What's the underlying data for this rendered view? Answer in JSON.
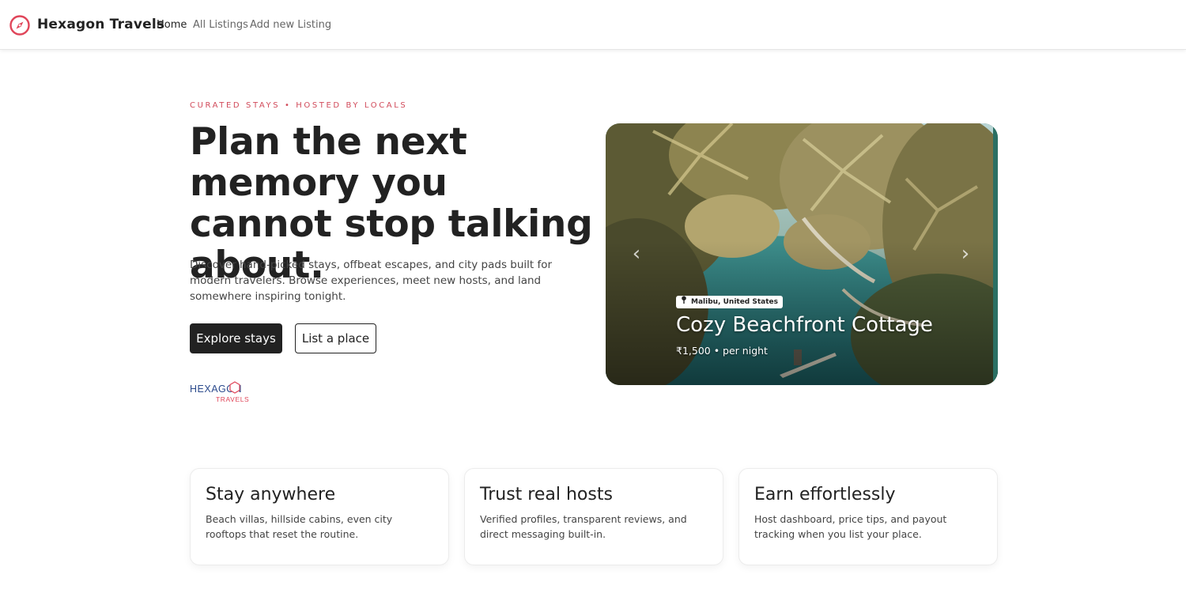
{
  "brand": {
    "name": "Hexagon Travels",
    "icon": "compass-icon",
    "accent": "#e0465a"
  },
  "nav": {
    "home": "Home",
    "all_listings": "All Listings",
    "add_listing": "Add new Listing"
  },
  "hero": {
    "eyebrow": "CURATED STAYS • HOSTED BY LOCALS",
    "title": "Plan the next memory you cannot stop talking about.",
    "text": "Discover hand-picked stays, offbeat escapes, and city pads built for modern travelers. Browse experiences, meet new hosts, and land somewhere inspiring tonight.",
    "primary_button": "Explore stays",
    "secondary_button": "List a place",
    "partner_logo": {
      "word": "HEXAGON",
      "sub": "TRAVELS"
    }
  },
  "carousel": {
    "location": "Malibu, United States",
    "title": "Cozy Beachfront Cottage",
    "price": "₹1,500 • per night",
    "prev_icon": "chevron-left-icon",
    "next_icon": "chevron-right-icon"
  },
  "features": [
    {
      "title": "Stay anywhere",
      "text": "Beach villas, hillside cabins, even city rooftops that reset the routine."
    },
    {
      "title": "Trust real hosts",
      "text": "Verified profiles, transparent reviews, and direct messaging built-in."
    },
    {
      "title": "Earn effortlessly",
      "text": "Host dashboard, price tips, and payout tracking when you list your place."
    }
  ]
}
